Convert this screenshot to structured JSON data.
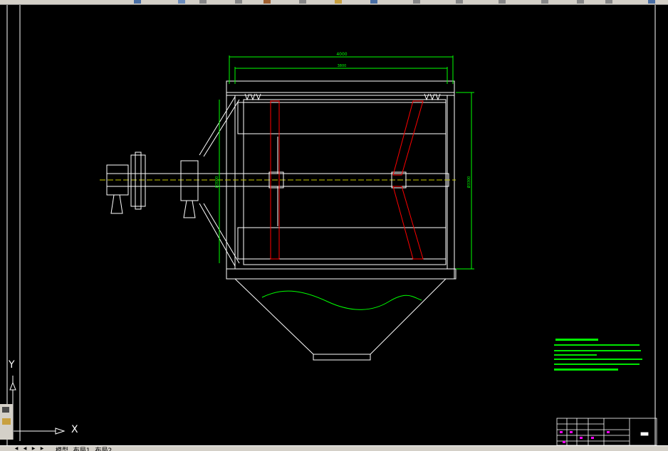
{
  "window": {
    "title": ""
  },
  "layout_tabs": [
    "模型",
    "布局1",
    "布局2"
  ],
  "ucs": {
    "x_label": "X",
    "y_label": "Y"
  },
  "drawing": {
    "dims": {
      "overall_width": "4000",
      "inner_width": "3800",
      "left_height": "Ø3000",
      "right_height": "Ø3300"
    },
    "colors": {
      "background": "#000000",
      "outline": "#ffffff",
      "dimension": "#00ff00",
      "blade": "#ff0000",
      "material": "#00ff00"
    }
  },
  "tech_requirements": {
    "heading": "",
    "lines": [
      "1.",
      "2.",
      "3.",
      "4.",
      "5.",
      "6."
    ]
  },
  "title_block": {
    "cells": []
  }
}
